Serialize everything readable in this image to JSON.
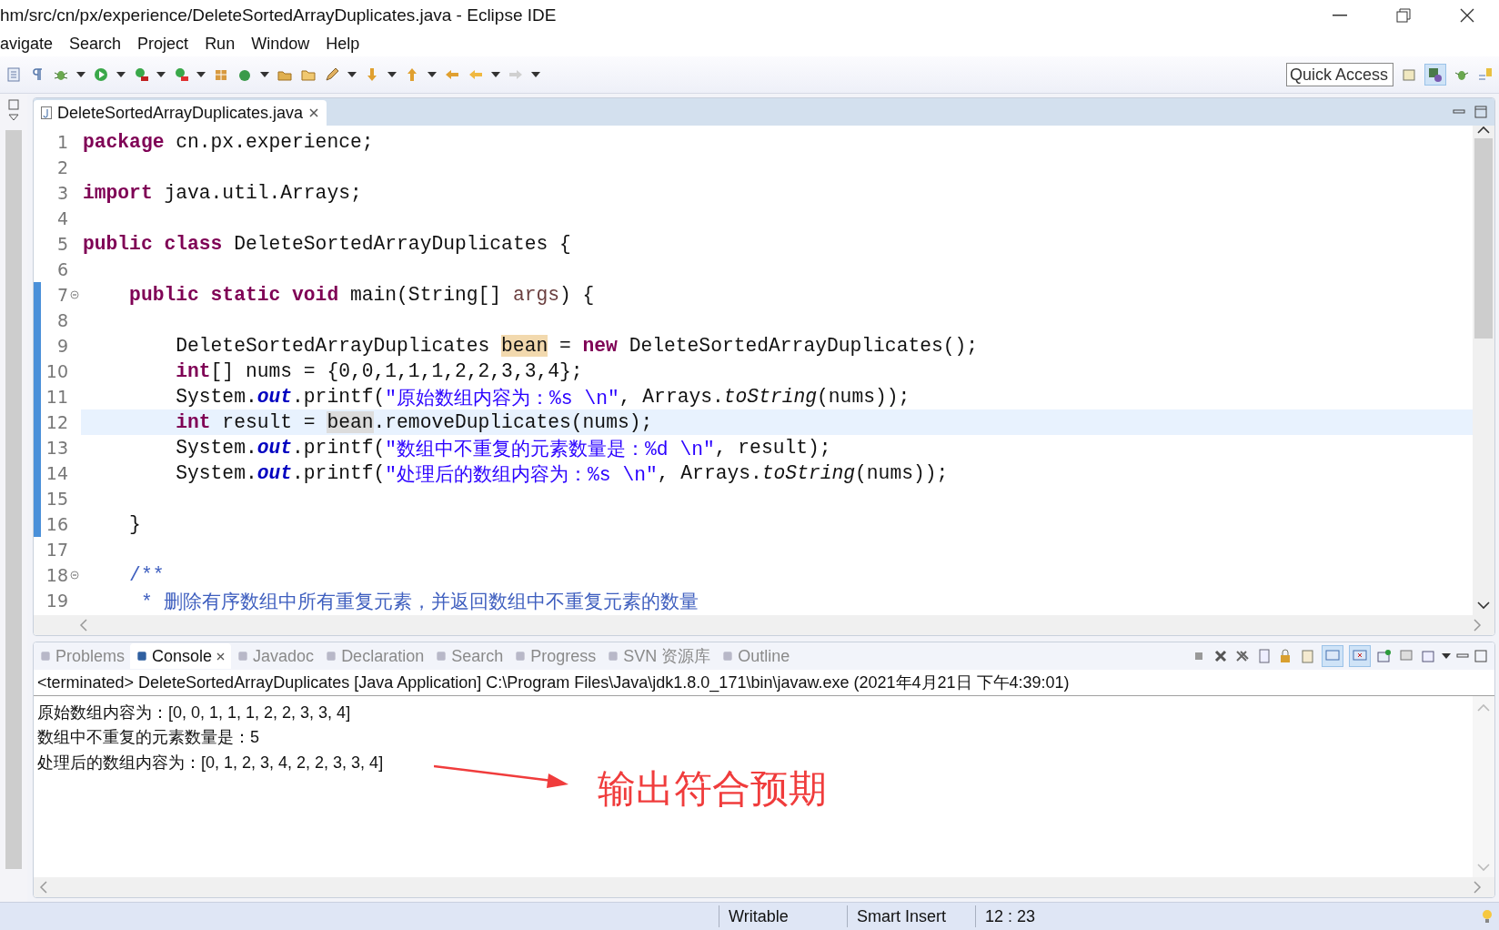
{
  "window": {
    "title": "hm/src/cn/px/experience/DeleteSortedArrayDuplicates.java - Eclipse IDE"
  },
  "menu": [
    "avigate",
    "Search",
    "Project",
    "Run",
    "Window",
    "Help"
  ],
  "quick_access": {
    "placeholder": "Quick Access"
  },
  "editor": {
    "tab": {
      "label": "DeleteSortedArrayDuplicates.java",
      "selected": true
    },
    "lines": [
      {
        "number": "1",
        "current": false,
        "range": false,
        "fold": false,
        "tokens": [
          {
            "kind": "keyword",
            "text": "package"
          },
          {
            "kind": "plain",
            "text": " cn.px.experience;"
          }
        ]
      },
      {
        "number": "2",
        "current": false,
        "range": false,
        "fold": false
      },
      {
        "number": "3",
        "current": false,
        "range": false,
        "fold": false,
        "tokens": [
          {
            "kind": "keyword",
            "text": "import"
          },
          {
            "kind": "plain",
            "text": " java.util.Arrays;"
          }
        ]
      },
      {
        "number": "4",
        "current": false,
        "range": false,
        "fold": false
      },
      {
        "number": "5",
        "current": false,
        "range": false,
        "fold": false,
        "tokens": [
          {
            "kind": "keyword",
            "text": "public class"
          },
          {
            "kind": "plain",
            "text": " DeleteSortedArrayDuplicates {"
          }
        ]
      },
      {
        "number": "6",
        "current": false,
        "range": false,
        "fold": false
      },
      {
        "number": "7",
        "current": false,
        "range": true,
        "fold": true,
        "tokens": [
          {
            "kind": "keyword",
            "text": "    public static void"
          },
          {
            "kind": "plain",
            "text": " main(String[] "
          },
          {
            "kind": "param",
            "text": "args"
          },
          {
            "kind": "plain",
            "text": ") {"
          }
        ]
      },
      {
        "number": "8",
        "current": false,
        "range": true,
        "fold": false
      },
      {
        "number": "9",
        "current": false,
        "range": true,
        "fold": false,
        "tokens": [
          {
            "kind": "plain",
            "text": "        DeleteSortedArrayDuplicates "
          },
          {
            "kind": "write-occurrence",
            "text": "bean"
          },
          {
            "kind": "plain",
            "text": " = "
          },
          {
            "kind": "keyword",
            "text": "new"
          },
          {
            "kind": "plain",
            "text": " DeleteSortedArrayDuplicates();"
          }
        ]
      },
      {
        "number": "10",
        "current": false,
        "range": true,
        "fold": false,
        "tokens": [
          {
            "kind": "keyword",
            "text": "        int"
          },
          {
            "kind": "plain",
            "text": "[] nums = {0,0,1,1,1,2,2,3,3,4};"
          }
        ]
      },
      {
        "number": "11",
        "current": false,
        "range": true,
        "fold": false,
        "tokens": [
          {
            "kind": "plain",
            "text": "        System."
          },
          {
            "kind": "field",
            "text": "out"
          },
          {
            "kind": "plain",
            "text": ".printf("
          },
          {
            "kind": "string",
            "text": "\"原始数组内容为：%s \\n\""
          },
          {
            "kind": "plain",
            "text": ", Arrays."
          },
          {
            "kind": "static",
            "text": "toString"
          },
          {
            "kind": "plain",
            "text": "(nums));"
          }
        ]
      },
      {
        "number": "12",
        "current": true,
        "range": true,
        "fold": false,
        "tokens": [
          {
            "kind": "keyword",
            "text": "        int"
          },
          {
            "kind": "plain",
            "text": " result = "
          },
          {
            "kind": "read-occurrence",
            "text": "bean"
          },
          {
            "kind": "plain",
            "text": ".removeDuplicates(nums);"
          }
        ]
      },
      {
        "number": "13",
        "current": false,
        "range": true,
        "fold": false,
        "tokens": [
          {
            "kind": "plain",
            "text": "        System."
          },
          {
            "kind": "field",
            "text": "out"
          },
          {
            "kind": "plain",
            "text": ".printf("
          },
          {
            "kind": "string",
            "text": "\"数组中不重复的元素数量是：%d \\n\""
          },
          {
            "kind": "plain",
            "text": ", result);"
          }
        ]
      },
      {
        "number": "14",
        "current": false,
        "range": true,
        "fold": false,
        "tokens": [
          {
            "kind": "plain",
            "text": "        System."
          },
          {
            "kind": "field",
            "text": "out"
          },
          {
            "kind": "plain",
            "text": ".printf("
          },
          {
            "kind": "string",
            "text": "\"处理后的数组内容为：%s \\n\""
          },
          {
            "kind": "plain",
            "text": ", Arrays."
          },
          {
            "kind": "static",
            "text": "toString"
          },
          {
            "kind": "plain",
            "text": "(nums));"
          }
        ]
      },
      {
        "number": "15",
        "current": false,
        "range": true,
        "fold": false
      },
      {
        "number": "16",
        "current": false,
        "range": true,
        "fold": false,
        "tokens": [
          {
            "kind": "plain",
            "text": "    }"
          }
        ]
      },
      {
        "number": "17",
        "current": false,
        "range": false,
        "fold": false
      },
      {
        "number": "18",
        "current": false,
        "range": false,
        "fold": true,
        "tokens": [
          {
            "kind": "comment",
            "text": "    /**"
          }
        ]
      },
      {
        "number": "19",
        "current": false,
        "range": false,
        "fold": false,
        "tokens": [
          {
            "kind": "comment",
            "text": "     * 删除有序数组中所有重复元素，并返回数组中不重复元素的数量"
          }
        ]
      }
    ]
  },
  "console": {
    "tabs": [
      {
        "label": "Problems",
        "selected": false
      },
      {
        "label": "Console",
        "selected": true
      },
      {
        "label": "Javadoc",
        "selected": false
      },
      {
        "label": "Declaration",
        "selected": false
      },
      {
        "label": "Search",
        "selected": false
      },
      {
        "label": "Progress",
        "selected": false
      },
      {
        "label": "SVN 资源库",
        "selected": false
      },
      {
        "label": "Outline",
        "selected": false
      }
    ],
    "header": "<terminated> DeleteSortedArrayDuplicates [Java Application] C:\\Program Files\\Java\\jdk1.8.0_171\\bin\\javaw.exe (2021年4月21日 下午4:39:01)",
    "output": [
      "原始数组内容为：[0, 0, 1, 1, 1, 2, 2, 3, 3, 4]",
      "数组中不重复的元素数量是：5",
      "处理后的数组内容为：[0, 1, 2, 3, 4, 2, 2, 3, 3, 4]"
    ],
    "annotation": "输出符合预期"
  },
  "status_bar": [
    "Writable",
    "Smart Insert",
    "12 : 23"
  ]
}
